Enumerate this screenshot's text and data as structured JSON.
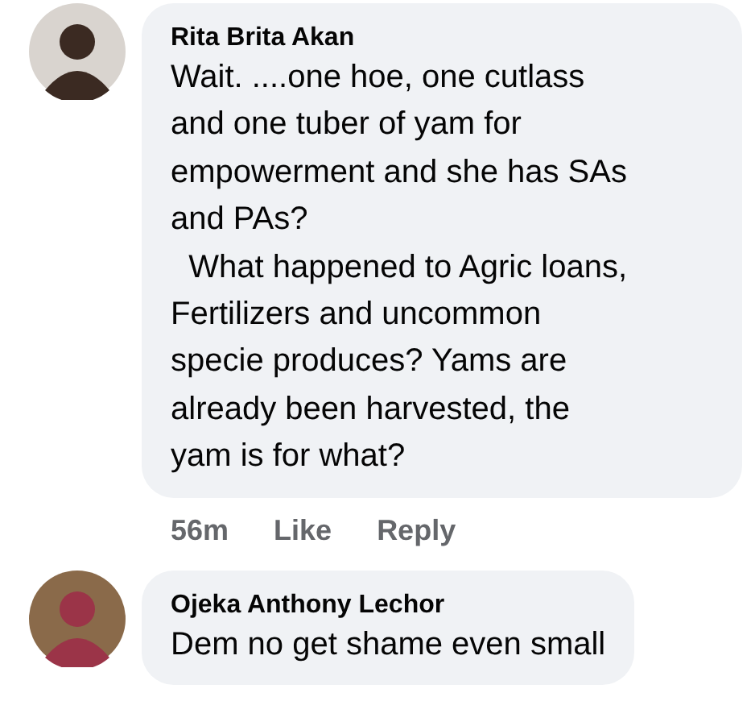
{
  "comments": [
    {
      "author": "Rita Brita Akan",
      "text": "Wait. ....one hoe, one cutlass\nand one tuber of yam for\nempowerment and she has SAs\nand PAs?\n  What happened to Agric loans,\nFertilizers and uncommon\nspecie produces? Yams are\nalready been harvested, the\nyam is for what?",
      "time": "56m",
      "actions": [
        "Like",
        "Reply"
      ]
    },
    {
      "author": "Ojeka Anthony Lechor",
      "text": "Dem no get shame even small"
    }
  ]
}
